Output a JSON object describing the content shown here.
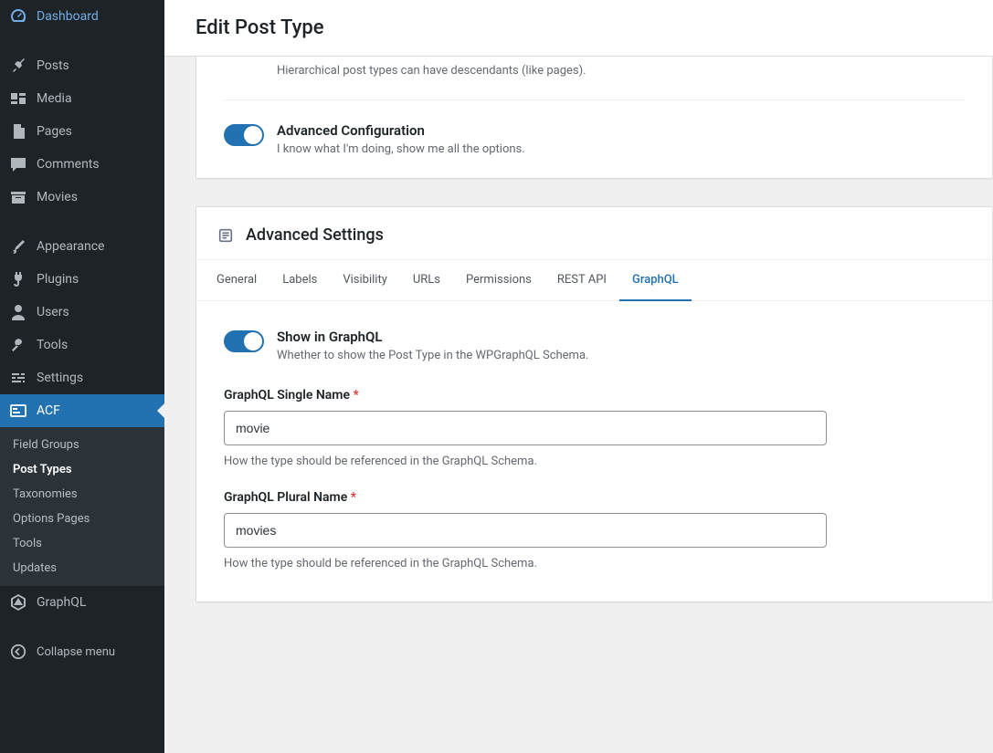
{
  "page": {
    "title": "Edit Post Type"
  },
  "sidebar": {
    "items": {
      "dashboard": "Dashboard",
      "posts": "Posts",
      "media": "Media",
      "pages": "Pages",
      "comments": "Comments",
      "movies": "Movies",
      "appearance": "Appearance",
      "plugins": "Plugins",
      "users": "Users",
      "tools": "Tools",
      "settings": "Settings",
      "acf": "ACF",
      "graphql": "GraphQL"
    },
    "submenu": {
      "field_groups": "Field Groups",
      "post_types": "Post Types",
      "taxonomies": "Taxonomies",
      "options_pages": "Options Pages",
      "tools": "Tools",
      "updates": "Updates"
    },
    "collapse": "Collapse menu"
  },
  "fields": {
    "hierarchical": {
      "desc": "Hierarchical post types can have descendants (like pages)."
    },
    "advanced_config": {
      "label": "Advanced Configuration",
      "desc": "I know what I'm doing, show me all the options."
    }
  },
  "advanced": {
    "title": "Advanced Settings",
    "tabs": {
      "general": "General",
      "labels": "Labels",
      "visibility": "Visibility",
      "urls": "URLs",
      "permissions": "Permissions",
      "rest_api": "REST API",
      "graphql": "GraphQL"
    },
    "show_in_graphql": {
      "label": "Show in GraphQL",
      "desc": "Whether to show the Post Type in the WPGraphQL Schema."
    },
    "single_name": {
      "label": "GraphQL Single Name",
      "value": "movie",
      "desc": "How the type should be referenced in the GraphQL Schema."
    },
    "plural_name": {
      "label": "GraphQL Plural Name",
      "value": "movies",
      "desc": "How the type should be referenced in the GraphQL Schema."
    }
  }
}
